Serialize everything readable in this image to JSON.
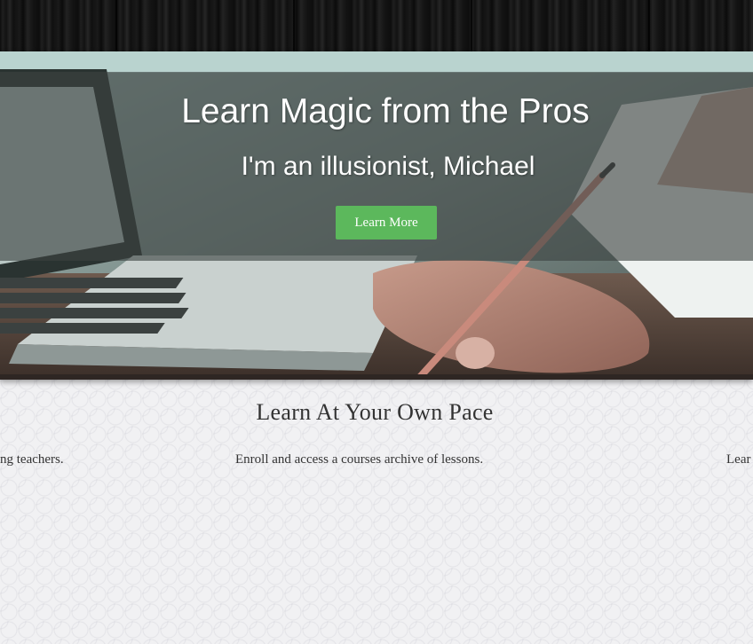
{
  "hero": {
    "title": "Learn Magic from the Pros",
    "subtitle": "I'm an illusionist, Michael",
    "button_label": "Learn More"
  },
  "section": {
    "heading": "Learn At Your Own Pace",
    "features": [
      "ng teachers.",
      "Enroll and access a courses archive of lessons.",
      "Lear"
    ]
  },
  "colors": {
    "button_green": "#5cb85c",
    "page_background": "#f1f1f3",
    "text_dark": "#333333"
  }
}
